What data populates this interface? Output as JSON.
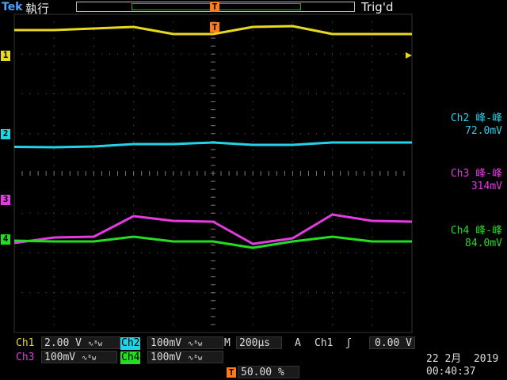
{
  "header": {
    "brand": "Tek",
    "run_state": "執行",
    "trigger_state": "Trig'd"
  },
  "markers": {
    "ch1": "1",
    "ch2": "2",
    "ch3": "3",
    "ch4": "4",
    "trigger_icon": "T"
  },
  "colors": {
    "ch1": "#e8d81e",
    "ch2": "#22d3e8",
    "ch3": "#e33be0",
    "ch4": "#22dd22",
    "trigger": "#ff7a1a"
  },
  "measurements": [
    {
      "title": "Ch2 峰-峰",
      "value": "72.0mV"
    },
    {
      "title": "Ch3 峰-峰",
      "value": "314mV"
    },
    {
      "title": "Ch4 峰-峰",
      "value": "84.0mV"
    }
  ],
  "settings": {
    "ch1_label": "Ch1",
    "ch1_scale": "2.00 V",
    "ch2_label": "Ch2",
    "ch2_scale": "100mV",
    "ch3_label": "Ch3",
    "ch3_scale": "100mV",
    "ch4_label": "Ch4",
    "ch4_scale": "100mV",
    "coupling_icon": "∿ᴮw",
    "timebase_label": "M",
    "timebase": "200µs",
    "trigger_mode": "A",
    "trigger_source": "Ch1",
    "trigger_slope": "ʃ",
    "trigger_level": "0.00 V",
    "trigger_position": "50.00 %",
    "date": "22 2月  2019",
    "time": "00:40:37"
  },
  "chart_data": {
    "type": "line",
    "x": [
      0,
      1,
      2,
      3,
      4,
      5,
      6,
      7,
      8,
      9,
      10
    ],
    "xlabel": "",
    "ylabel": "",
    "grid": true,
    "series": [
      {
        "values": [
          3.2,
          3.2,
          3.4,
          3.6,
          2.7,
          2.7,
          3.6,
          3.7,
          2.7,
          2.7,
          2.7
        ]
      },
      {
        "values": [
          0.05,
          0.0,
          0.1,
          0.4,
          0.4,
          0.6,
          0.3,
          0.3,
          0.6,
          0.6,
          0.6
        ]
      },
      {
        "values": [
          0.3,
          1.0,
          1.1,
          3.7,
          3.1,
          3.0,
          0.2,
          0.9,
          3.9,
          3.1,
          3.0
        ]
      },
      {
        "values": [
          0.1,
          0.0,
          0.0,
          0.6,
          0.0,
          0.0,
          -0.8,
          0.0,
          0.6,
          0.0,
          0.0
        ]
      }
    ]
  }
}
